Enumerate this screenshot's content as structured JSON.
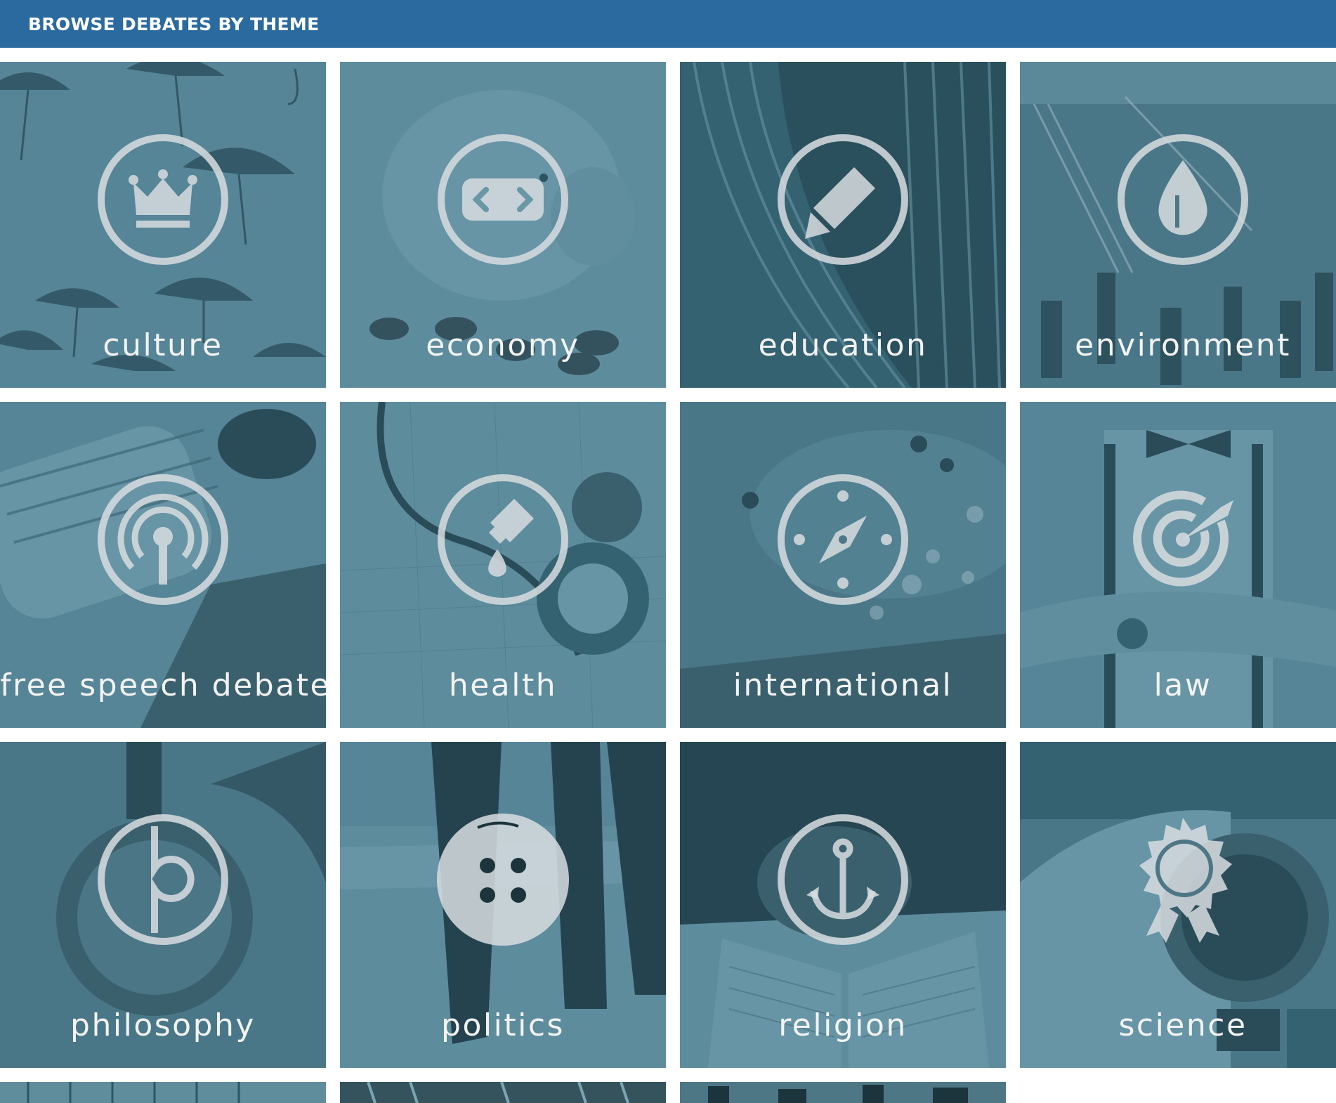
{
  "header": {
    "title": "BROWSE DEBATES BY THEME"
  },
  "colors": {
    "header_bg": "#2b6a9e",
    "tile_tint": "#5a8796",
    "icon_stroke": "#d8dde0",
    "label_text": "#f3f3f3"
  },
  "themes": [
    {
      "label": "culture",
      "icon": "crown-icon"
    },
    {
      "label": "economy",
      "icon": "code-brackets-icon"
    },
    {
      "label": "education",
      "icon": "pencil-icon"
    },
    {
      "label": "environment",
      "icon": "water-drop-icon"
    },
    {
      "label": "free speech debate",
      "icon": "broadcast-icon"
    },
    {
      "label": "health",
      "icon": "dropper-icon"
    },
    {
      "label": "international",
      "icon": "compass-icon"
    },
    {
      "label": "law",
      "icon": "target-icon"
    },
    {
      "label": "philosophy",
      "icon": "philosophy-symbol-icon"
    },
    {
      "label": "politics",
      "icon": "dots-icon"
    },
    {
      "label": "religion",
      "icon": "anchor-icon"
    },
    {
      "label": "science",
      "icon": "award-badge-icon"
    }
  ]
}
